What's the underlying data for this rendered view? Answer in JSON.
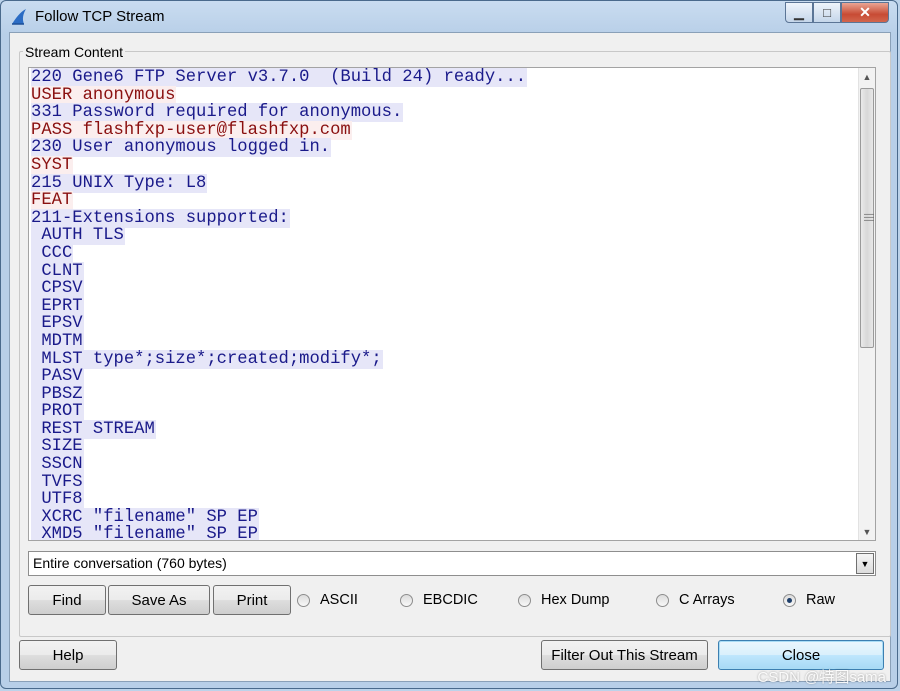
{
  "window": {
    "title": "Follow TCP Stream",
    "minimize_glyph": "▁",
    "maximize_glyph": "□",
    "close_glyph": "✕"
  },
  "stream": {
    "group_label": "Stream Content",
    "lines": [
      {
        "dir": "server",
        "text": "220 Gene6 FTP Server v3.7.0  (Build 24) ready..."
      },
      {
        "dir": "client",
        "text": "USER anonymous"
      },
      {
        "dir": "server",
        "text": "331 Password required for anonymous."
      },
      {
        "dir": "client",
        "text": "PASS flashfxp-user@flashfxp.com"
      },
      {
        "dir": "server",
        "text": "230 User anonymous logged in."
      },
      {
        "dir": "client",
        "text": "SYST"
      },
      {
        "dir": "server",
        "text": "215 UNIX Type: L8"
      },
      {
        "dir": "client",
        "text": "FEAT"
      },
      {
        "dir": "server",
        "text": "211-Extensions supported:"
      },
      {
        "dir": "server",
        "text": " AUTH TLS"
      },
      {
        "dir": "server",
        "text": " CCC"
      },
      {
        "dir": "server",
        "text": " CLNT"
      },
      {
        "dir": "server",
        "text": " CPSV"
      },
      {
        "dir": "server",
        "text": " EPRT"
      },
      {
        "dir": "server",
        "text": " EPSV"
      },
      {
        "dir": "server",
        "text": " MDTM"
      },
      {
        "dir": "server",
        "text": " MLST type*;size*;created;modify*;"
      },
      {
        "dir": "server",
        "text": " PASV"
      },
      {
        "dir": "server",
        "text": " PBSZ"
      },
      {
        "dir": "server",
        "text": " PROT"
      },
      {
        "dir": "server",
        "text": " REST STREAM"
      },
      {
        "dir": "server",
        "text": " SIZE"
      },
      {
        "dir": "server",
        "text": " SSCN"
      },
      {
        "dir": "server",
        "text": " TVFS"
      },
      {
        "dir": "server",
        "text": " UTF8"
      },
      {
        "dir": "server",
        "text": " XCRC \"filename\" SP EP"
      },
      {
        "dir": "server",
        "text": " XMD5 \"filename\" SP EP"
      }
    ],
    "colors": {
      "server_text": "#1a1a8a",
      "server_bg": "#e6e6f8",
      "client_text": "#8a1010",
      "client_bg": "#fbeeee"
    }
  },
  "conversation_select": {
    "value": "Entire conversation (760 bytes)"
  },
  "actions": {
    "find": "Find",
    "save_as": "Save As",
    "print": "Print"
  },
  "formats": [
    {
      "label": "ASCII",
      "selected": false
    },
    {
      "label": "EBCDIC",
      "selected": false
    },
    {
      "label": "Hex Dump",
      "selected": false
    },
    {
      "label": "C Arrays",
      "selected": false
    },
    {
      "label": "Raw",
      "selected": true
    }
  ],
  "footer": {
    "help": "Help",
    "filter_out": "Filter Out This Stream",
    "close": "Close"
  },
  "watermark": "CSDN @特图sama"
}
